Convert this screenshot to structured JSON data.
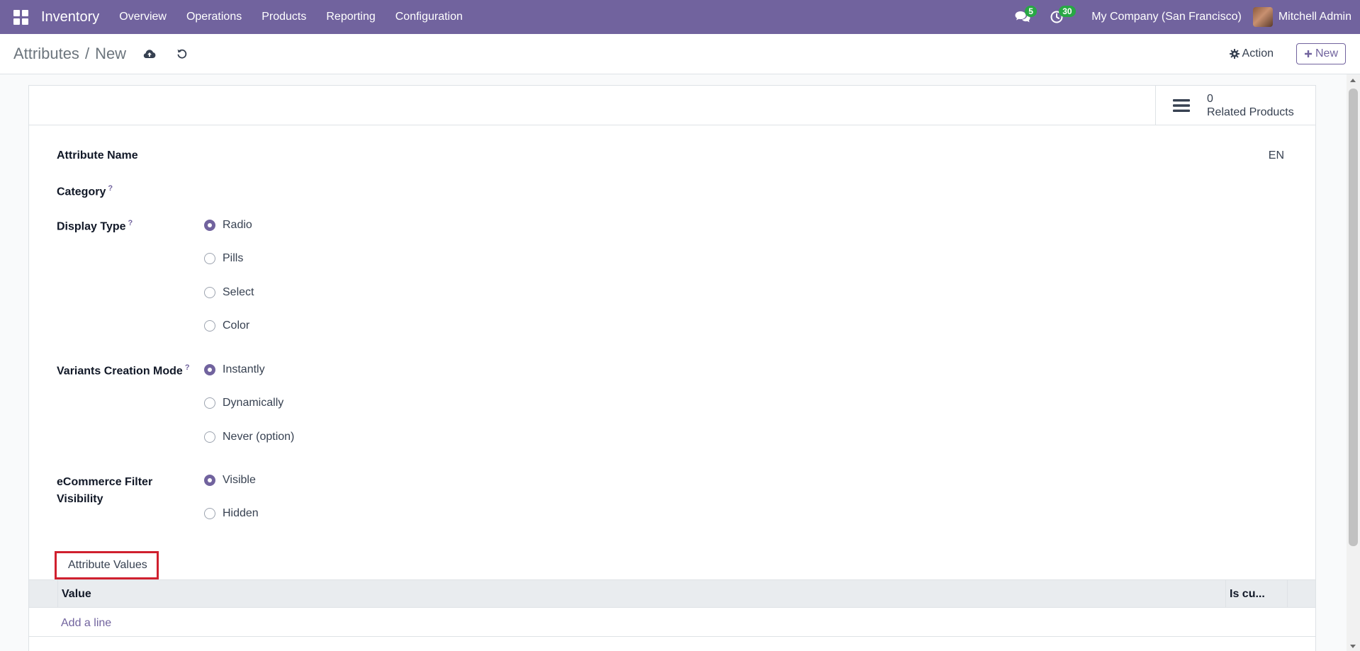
{
  "navbar": {
    "brand": "Inventory",
    "menu": [
      "Overview",
      "Operations",
      "Products",
      "Reporting",
      "Configuration"
    ],
    "messages_count": "5",
    "activities_count": "30",
    "company": "My Company (San Francisco)",
    "user": "Mitchell Admin"
  },
  "control_panel": {
    "breadcrumb_parent": "Attributes",
    "breadcrumb_separator": "/",
    "breadcrumb_current": "New",
    "action_label": "Action",
    "new_label": "New"
  },
  "stat_button": {
    "count": "0",
    "label": "Related Products"
  },
  "form": {
    "attribute_name_label": "Attribute Name",
    "lang": "EN",
    "category_label": "Category",
    "help_mark": "?",
    "display_type_label": "Display Type",
    "display_type_options": [
      "Radio",
      "Pills",
      "Select",
      "Color"
    ],
    "display_type_selected": "Radio",
    "variants_label": "Variants Creation Mode",
    "variants_options": [
      "Instantly",
      "Dynamically",
      "Never (option)"
    ],
    "variants_selected": "Instantly",
    "ecommerce_label_line1": "eCommerce Filter",
    "ecommerce_label_line2": "Visibility",
    "ecommerce_options": [
      "Visible",
      "Hidden"
    ],
    "ecommerce_selected": "Visible"
  },
  "notebook": {
    "tab_label": "Attribute Values",
    "columns": [
      "Value",
      "Is cu..."
    ],
    "add_line": "Add a line"
  },
  "colors": {
    "brand": "#71639e",
    "badge": "#28a745",
    "highlight": "#d0202e"
  }
}
